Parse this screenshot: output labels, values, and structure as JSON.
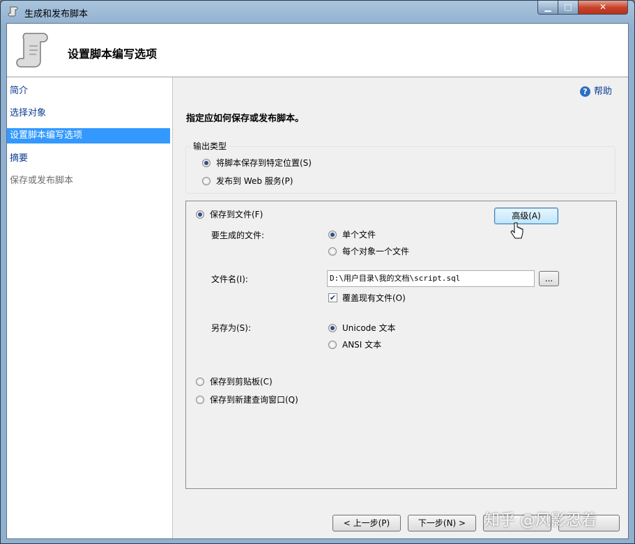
{
  "window": {
    "title": "生成和发布脚本"
  },
  "header": {
    "title": "设置脚本编写选项"
  },
  "sidebar": {
    "items": [
      {
        "label": "简介",
        "state": "normal"
      },
      {
        "label": "选择对象",
        "state": "normal"
      },
      {
        "label": "设置脚本编写选项",
        "state": "active"
      },
      {
        "label": "摘要",
        "state": "normal"
      },
      {
        "label": "保存或发布脚本",
        "state": "disabled"
      }
    ]
  },
  "help": {
    "label": "帮助",
    "icon": "help-question-icon"
  },
  "main": {
    "section_title": "指定应如何保存或发布脚本。",
    "output_type": {
      "label": "输出类型",
      "options": [
        {
          "label": "将脚本保存到特定位置(S)",
          "checked": true
        },
        {
          "label": "发布到 Web 服务(P)",
          "checked": false
        }
      ]
    },
    "save_to_file": {
      "label": "保存到文件(F)",
      "checked": true,
      "advanced_button": "高级(A)",
      "files_to_generate": {
        "label": "要生成的文件:",
        "options": [
          {
            "label": "单个文件",
            "checked": true
          },
          {
            "label": "每个对象一个文件",
            "checked": false
          }
        ]
      },
      "file_name": {
        "label": "文件名(I):",
        "value": "D:\\用户目录\\我的文档\\script.sql",
        "browse_button": "..."
      },
      "overwrite": {
        "label": "覆盖现有文件(O)",
        "checked": true
      },
      "save_as": {
        "label": "另存为(S):",
        "options": [
          {
            "label": "Unicode 文本",
            "checked": true
          },
          {
            "label": "ANSI 文本",
            "checked": false
          }
        ]
      }
    },
    "save_to_clipboard": {
      "label": "保存到剪贴板(C)",
      "checked": false
    },
    "save_to_query_window": {
      "label": "保存到新建查询窗口(Q)",
      "checked": false
    }
  },
  "footer": {
    "prev_button": "< 上一步(P)",
    "next_button": "下一步(N) >",
    "finish_button": "",
    "cancel_button": ""
  },
  "watermark": "知乎 @风影忍着",
  "colors": {
    "selection": "#3399ff",
    "link": "#0b3d91",
    "close_button": "#c8452c"
  }
}
